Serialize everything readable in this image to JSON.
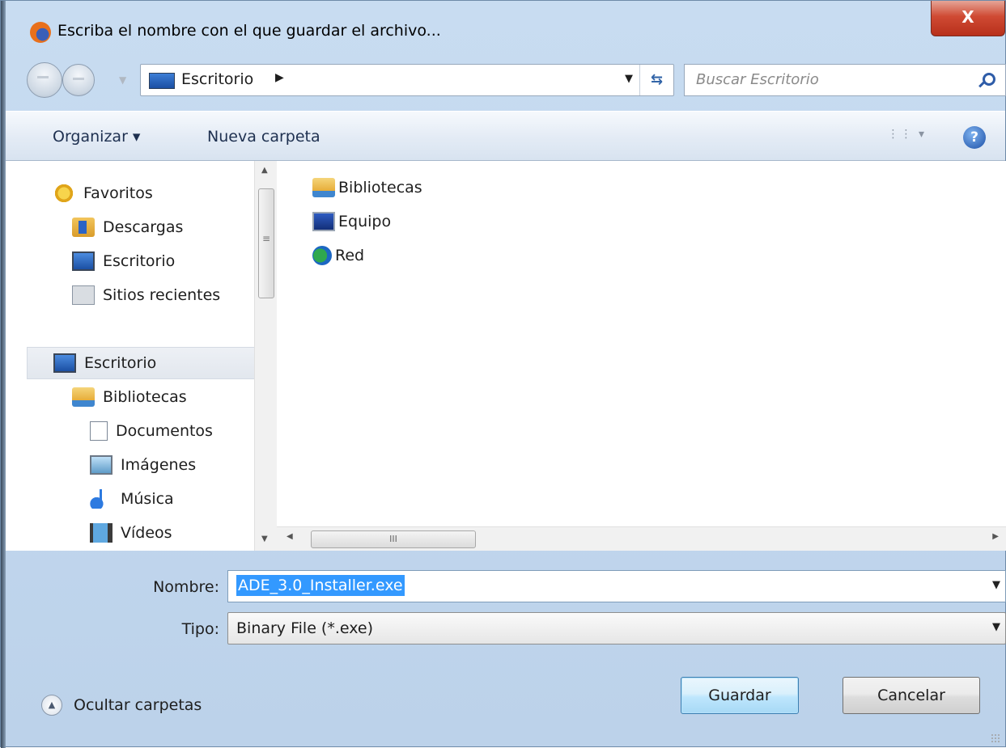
{
  "window": {
    "title": "Escriba el nombre con el que guardar el archivo...",
    "close_label": "X"
  },
  "address": {
    "location": "Escritorio",
    "search_placeholder": "Buscar Escritorio"
  },
  "toolbar": {
    "organize_label": "Organizar ▾",
    "new_folder_label": "Nueva carpeta",
    "help_label": "?"
  },
  "sidebar": {
    "favorites_header": "Favoritos",
    "favorites": [
      {
        "label": "Descargas",
        "icon": "downloads-icon"
      },
      {
        "label": "Escritorio",
        "icon": "desktop-icon"
      },
      {
        "label": "Sitios recientes",
        "icon": "recent-places-icon"
      }
    ],
    "desktop_label": "Escritorio",
    "libraries_label": "Bibliotecas",
    "libraries": [
      {
        "label": "Documentos",
        "icon": "documents-icon"
      },
      {
        "label": "Imágenes",
        "icon": "pictures-icon"
      },
      {
        "label": "Música",
        "icon": "music-icon"
      },
      {
        "label": "Vídeos",
        "icon": "videos-icon"
      }
    ]
  },
  "files": [
    {
      "label": "Bibliotecas",
      "icon": "libraries-icon"
    },
    {
      "label": "Equipo",
      "icon": "computer-icon"
    },
    {
      "label": "Red",
      "icon": "network-icon"
    }
  ],
  "scroll_marks": {
    "grip": "≡",
    "hgrip": "III"
  },
  "form": {
    "filename_label": "Nombre:",
    "filename_value": "ADE_3.0_Installer.exe",
    "type_label": "Tipo:",
    "type_value": "Binary File (*.exe)"
  },
  "footer": {
    "hide_folders_label": "Ocultar carpetas",
    "save_label": "Guardar",
    "cancel_label": "Cancelar"
  }
}
